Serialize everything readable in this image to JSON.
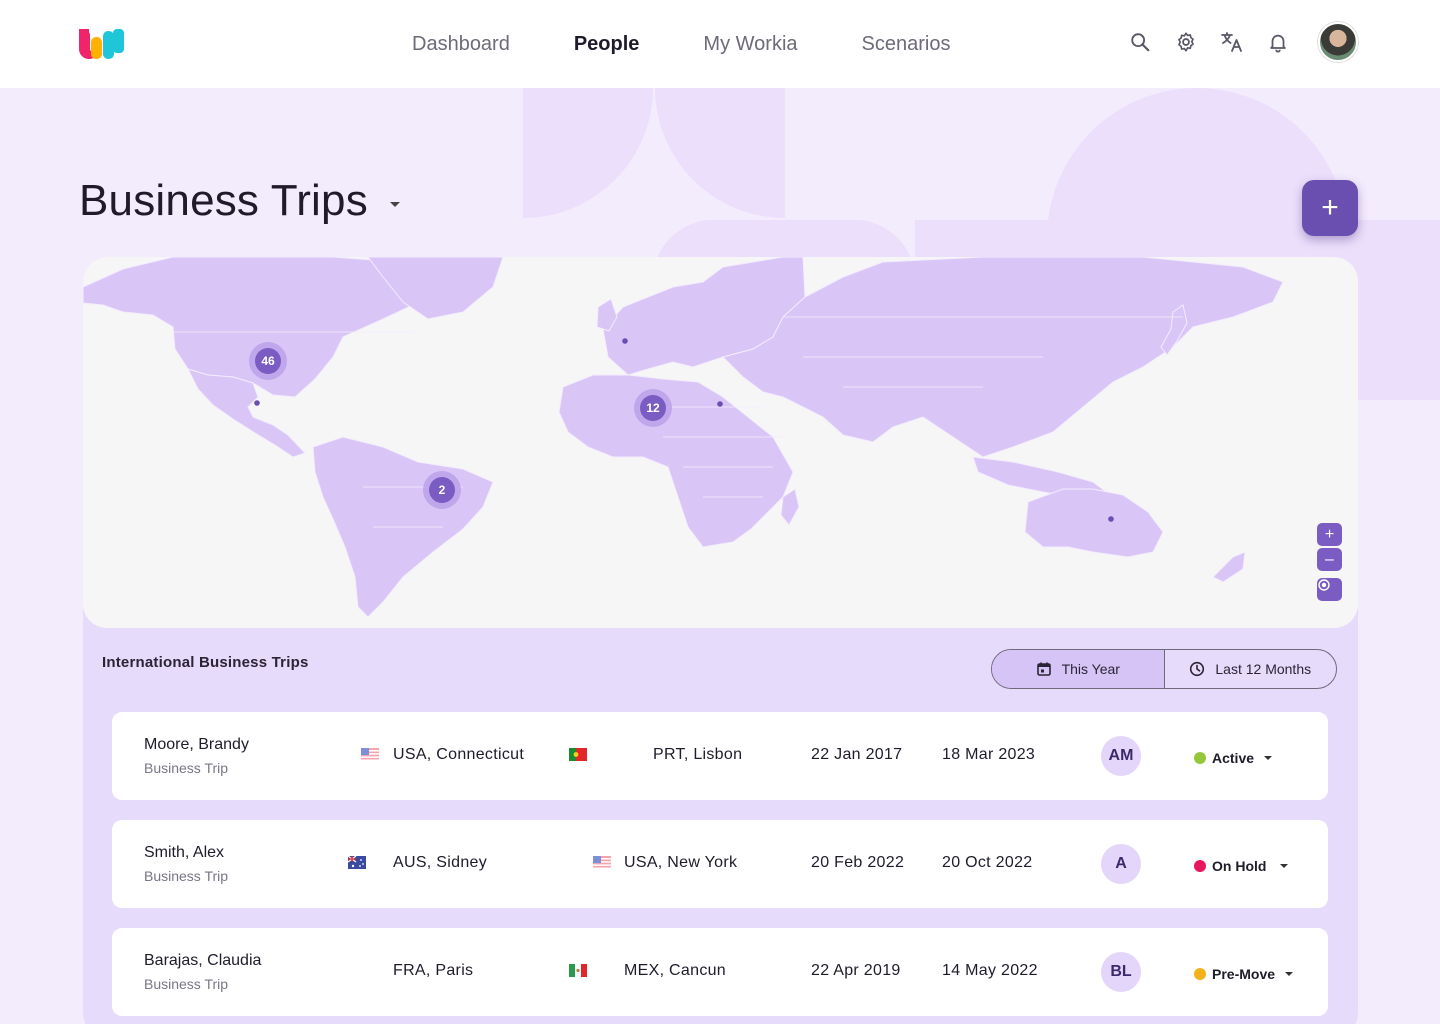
{
  "header": {
    "nav": [
      {
        "label": "Dashboard",
        "active": false
      },
      {
        "label": "People",
        "active": true
      },
      {
        "label": "My Workia",
        "active": false
      },
      {
        "label": "Scenarios",
        "active": false
      }
    ],
    "icons": [
      "search-icon",
      "gear-icon",
      "translate-icon",
      "bell-icon"
    ]
  },
  "page": {
    "title": "Business Trips",
    "add_label": "+"
  },
  "map": {
    "clusters": [
      {
        "count": "46"
      },
      {
        "count": "12"
      },
      {
        "count": "2"
      }
    ],
    "zoom_in": "+",
    "zoom_out": "–"
  },
  "trips": {
    "section_title": "International Business Trips",
    "filters": [
      {
        "label": "This Year",
        "icon": "calendar-icon",
        "selected": true
      },
      {
        "label": "Last 12 Months",
        "icon": "clock-icon",
        "selected": false
      }
    ],
    "rows": [
      {
        "name": "Moore, Brandy",
        "type": "Business Trip",
        "from": "USA, Connecticut",
        "from_flag": "us-flag",
        "to": "PRT, Lisbon",
        "to_flag": "pt-flag",
        "start": "22 Jan 2017",
        "end": "18 Mar 2023",
        "initials": "AM",
        "status": "Active",
        "status_color": "#93c83a"
      },
      {
        "name": "Smith, Alex",
        "type": "Business Trip",
        "from": "AUS, Sidney",
        "from_flag": "au-flag",
        "to": "USA, New York",
        "to_flag": "us-flag",
        "start": "20 Feb 2022",
        "end": "20 Oct 2022",
        "initials": "A",
        "status": "On Hold",
        "status_color": "#e8165c"
      },
      {
        "name": "Barajas, Claudia",
        "type": "Business Trip",
        "from": "FRA, Paris",
        "from_flag": "",
        "to": "MEX, Cancun",
        "to_flag": "mx-flag",
        "start": "22 Apr 2019",
        "end": "14 May 2022",
        "initials": "BL",
        "status": "Pre-Move",
        "status_color": "#f3b21a"
      }
    ]
  },
  "colors": {
    "accent": "#6a4fb0",
    "land": "#d9c6f6",
    "cluster": "#7b5cc3"
  }
}
